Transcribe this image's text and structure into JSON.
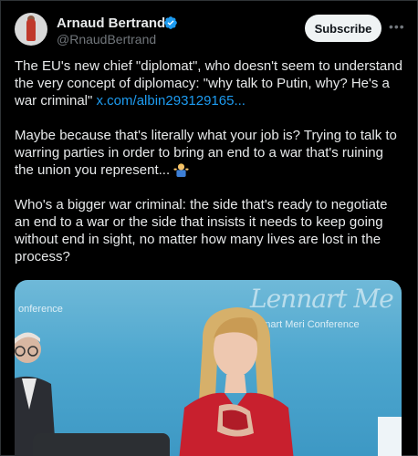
{
  "author": {
    "name": "Arnaud Bertrand",
    "handle": "@RnaudBertrand",
    "verified_color": "#1d9bf0"
  },
  "actions": {
    "subscribe_label": "Subscribe",
    "more_icon": "more-horizontal-icon"
  },
  "tweet": {
    "p1_text": "The EU's new chief \"diplomat\", who doesn't seem to understand the very concept of diplomacy: \"why talk to Putin, why? He's a war criminal\" ",
    "p1_link": "x.com/albin293129165...",
    "p2_text": "Maybe because that's literally what your job is? Trying to talk to warring parties in order to bring an end to a war that's ruining the union you represent... ",
    "p2_emoji": "person-shrugging-emoji",
    "p3_text": "Who's a bigger war criminal: the side that's ready to negotiate an end to a war or the side that insists it needs to keep going without end in sight, no matter how many lives are lost in the process?"
  },
  "media": {
    "bg_text_left": "onference",
    "bg_text_right": "ennart Meri Conference",
    "bg_script": "Lennart Me"
  },
  "colors": {
    "background": "#000000",
    "text": "#e7e9ea",
    "secondary": "#71767b",
    "link": "#1d9bf0",
    "media_blue": "#4ea7cf",
    "dress_red": "#c8202e"
  }
}
